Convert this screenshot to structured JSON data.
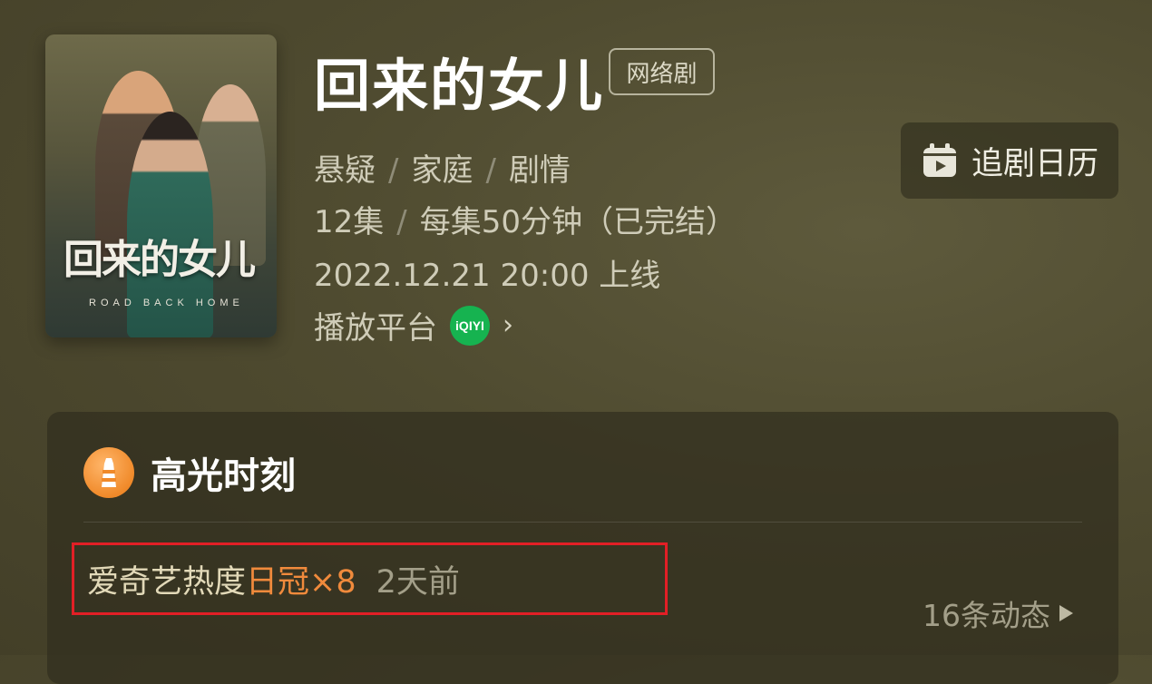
{
  "poster": {
    "title": "回来的女儿",
    "subtitle": "ROAD BACK HOME"
  },
  "show": {
    "title": "回来的女儿",
    "type_tag": "网络剧",
    "genres": [
      "悬疑",
      "家庭",
      "剧情"
    ],
    "episodes": "12集",
    "duration": "每集50分钟（已完结）",
    "release": "2022.12.21 20:00 上线",
    "platform_label": "播放平台",
    "platform_logo_text": "iQIYI"
  },
  "calendar_button": {
    "label": "追剧日历",
    "icon": "calendar-icon"
  },
  "highlights": {
    "title": "高光时刻",
    "icon": "lighthouse-icon",
    "item": {
      "prefix": "爱奇艺热度",
      "rank": "日冠×8",
      "time": "2天前"
    },
    "more_label": "16条动态"
  },
  "colors": {
    "accent_orange": "#f08a3c",
    "platform_green": "#16b350",
    "highlight_border": "#e21f26"
  }
}
